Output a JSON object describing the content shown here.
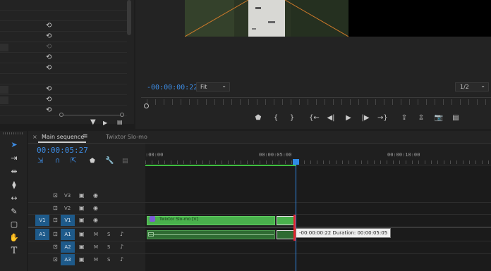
{
  "program_monitor": {
    "timecode": "-00:00:00:22",
    "fit": "Fit",
    "resolution": "1/2",
    "fit_caret": "⌄",
    "res_caret": "⌄"
  },
  "timeline": {
    "tabs": [
      "Main sequence",
      "Twixtor Slo-mo"
    ],
    "tab_close": "×",
    "tab_menu": "≡",
    "timecode": "00:00:05:27",
    "ruler_labels": [
      ":00:00",
      "00:00:05:00",
      "00:00:10:00"
    ],
    "video_tracks": [
      {
        "label": "V3"
      },
      {
        "label": "V2"
      },
      {
        "label": "V1",
        "source": "V1"
      }
    ],
    "audio_tracks": [
      {
        "label": "A1",
        "source": "A1",
        "m": "M",
        "s": "S"
      },
      {
        "label": "A2",
        "m": "M",
        "s": "S"
      },
      {
        "label": "A3",
        "m": "M",
        "s": "S"
      }
    ],
    "clip_label": "Twixtor Slo-mo [V]",
    "tooltip": "-00:00:00:22 Duration: 00:00:05:05"
  },
  "icons": {
    "reset": "⟲",
    "lock": "🔒",
    "eye": "👁",
    "film": "▣",
    "mic": "🎙",
    "play": "▶",
    "step_back": "◀|",
    "step_fwd": "|▶",
    "go_in": "{←",
    "go_out": "→}",
    "marker": "⬟",
    "in_bracket": "{",
    "out_bracket": "}",
    "lift": "⇪",
    "extract": "⇫",
    "camera": "📷",
    "compare": "▤",
    "filter": "▼",
    "wrench": "🔧"
  }
}
